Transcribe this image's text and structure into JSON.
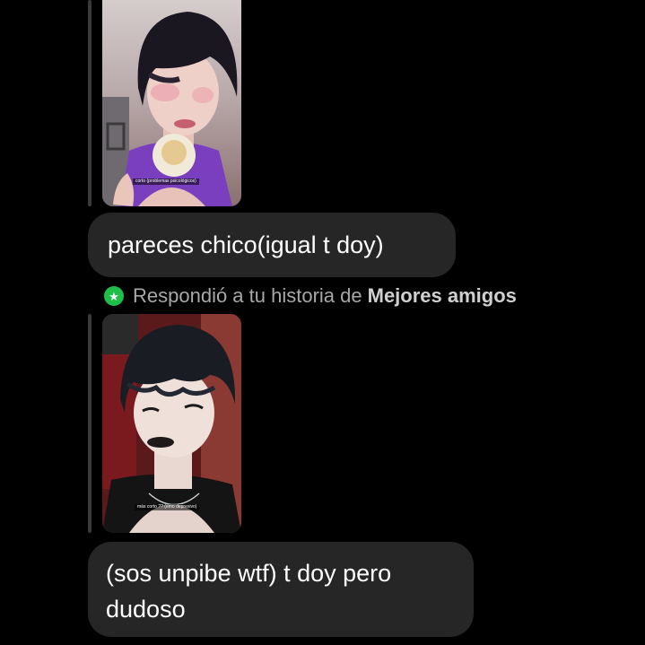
{
  "colors": {
    "background": "#000000",
    "bubble": "#262626",
    "reply_line": "#3a3a3a",
    "best_friends_green": "#1fbf4a",
    "muted_text": "#a8a8a8"
  },
  "thread": {
    "story_1": {
      "caption": "corto (problemas psicológicos)"
    },
    "message_1": {
      "text": "pareces chico(igual t doy)"
    },
    "reply_status": {
      "icon": "star-icon",
      "prefix": "Respondió a tu historia de",
      "highlight": "Mejores amigos"
    },
    "story_2": {
      "caption": "más corto ?? (emo depresivo)"
    },
    "message_2": {
      "text": "(sos unpibe wtf) t doy pero dudoso"
    }
  }
}
